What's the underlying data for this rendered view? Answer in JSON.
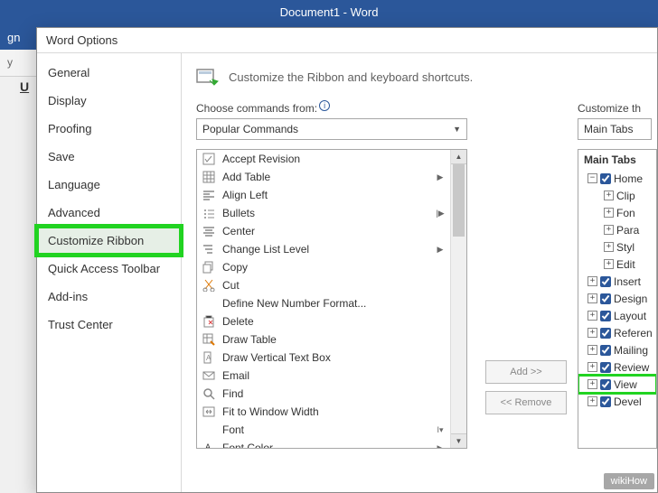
{
  "app": {
    "title": "Document1 - Word"
  },
  "ribbon_bg": {
    "gn": "gn",
    "tab1": "",
    "tab2": "",
    "tab3": "",
    "tell": "",
    "y": "y",
    "u": "U"
  },
  "dialog": {
    "title": "Word Options",
    "categories": [
      "General",
      "Display",
      "Proofing",
      "Save",
      "Language",
      "Advanced",
      "Customize Ribbon",
      "Quick Access Toolbar",
      "Add-ins",
      "Trust Center"
    ],
    "selected_category_index": 6,
    "header_text": "Customize the Ribbon and keyboard shortcuts.",
    "choose_label": "Choose commands from:",
    "choose_value": "Popular Commands",
    "customize_label": "Customize th",
    "customize_value": "Main Tabs",
    "commands": [
      {
        "icon": "check",
        "text": "Accept Revision",
        "sub": ""
      },
      {
        "icon": "table",
        "text": "Add Table",
        "sub": "▶"
      },
      {
        "icon": "align-left",
        "text": "Align Left",
        "sub": ""
      },
      {
        "icon": "bullets",
        "text": "Bullets",
        "sub": "|▶"
      },
      {
        "icon": "center",
        "text": "Center",
        "sub": ""
      },
      {
        "icon": "list-level",
        "text": "Change List Level",
        "sub": "▶"
      },
      {
        "icon": "copy",
        "text": "Copy",
        "sub": ""
      },
      {
        "icon": "cut",
        "text": "Cut",
        "sub": ""
      },
      {
        "icon": "blank",
        "text": "Define New Number Format...",
        "sub": ""
      },
      {
        "icon": "delete",
        "text": "Delete",
        "sub": ""
      },
      {
        "icon": "draw-table",
        "text": "Draw Table",
        "sub": ""
      },
      {
        "icon": "textbox",
        "text": "Draw Vertical Text Box",
        "sub": ""
      },
      {
        "icon": "email",
        "text": "Email",
        "sub": ""
      },
      {
        "icon": "find",
        "text": "Find",
        "sub": ""
      },
      {
        "icon": "fit",
        "text": "Fit to Window Width",
        "sub": ""
      },
      {
        "icon": "blank",
        "text": "Font",
        "sub": "I▾"
      },
      {
        "icon": "font-color",
        "text": "Font Color",
        "sub": "▶"
      }
    ],
    "add_btn": "Add >>",
    "remove_btn": "<< Remove",
    "tree": {
      "header": "Main Tabs",
      "root": {
        "label": "Home",
        "children": [
          {
            "label": "Clip"
          },
          {
            "label": "Fon"
          },
          {
            "label": "Para"
          },
          {
            "label": "Styl"
          },
          {
            "label": "Edit"
          }
        ]
      },
      "tabs": [
        {
          "label": "Insert"
        },
        {
          "label": "Design"
        },
        {
          "label": "Layout"
        },
        {
          "label": "Referen"
        },
        {
          "label": "Mailing"
        },
        {
          "label": "Review"
        },
        {
          "label": "View",
          "highlight": true
        },
        {
          "label": "Devel"
        }
      ]
    }
  },
  "watermark": "wikiHow"
}
